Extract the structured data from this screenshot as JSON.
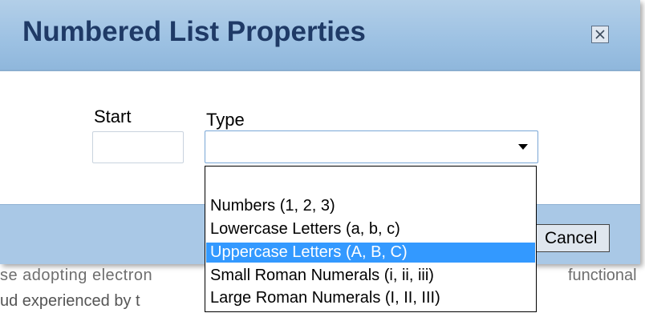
{
  "dialog": {
    "title": "Numbered List Properties",
    "close_icon": "close-icon",
    "start_label": "Start",
    "start_value": "",
    "type_label": "Type",
    "type_value": "",
    "cancel_label": "Cancel"
  },
  "type_options": [
    "",
    "Numbers (1, 2, 3)",
    "Lowercase Letters (a, b, c)",
    "Uppercase Letters (A, B, C)",
    "Small Roman Numerals (i, ii, iii)",
    "Large Roman Numerals (I, II, III)"
  ],
  "selected_option": "Uppercase Letters (A, B, C)",
  "background_text": {
    "line1_left": "se adopting electron",
    "line1_right": "functional",
    "line2": "ud experienced by t"
  },
  "colors": {
    "titlebar": "#9ec2e3",
    "title_text": "#1f3a66",
    "footer": "#a9c8e6",
    "selection": "#3399ff"
  }
}
